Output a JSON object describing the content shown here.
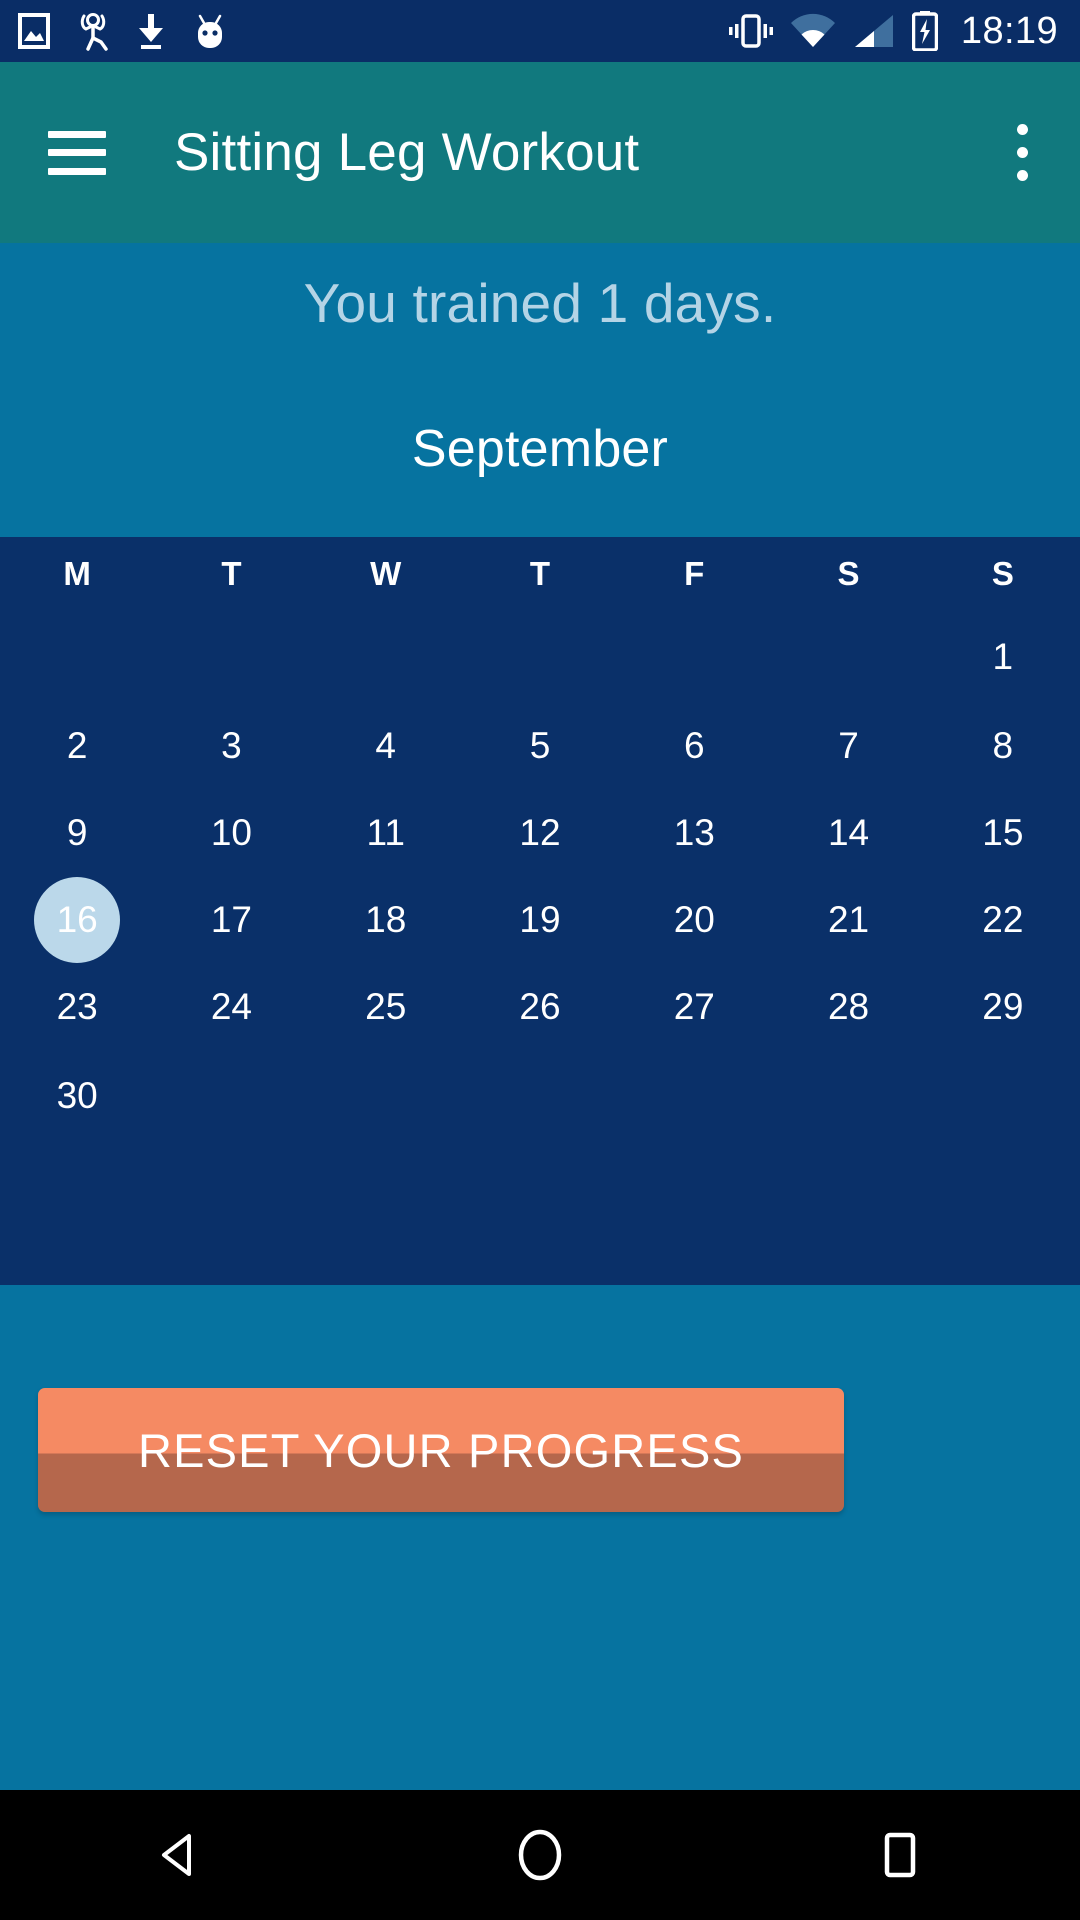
{
  "statusbar": {
    "time": "18:19",
    "left_icons": [
      {
        "name": "image-icon"
      },
      {
        "name": "exercise-person-icon"
      },
      {
        "name": "download-icon"
      },
      {
        "name": "android-mascot-icon"
      }
    ],
    "right_icons": [
      {
        "name": "vibrate-icon"
      },
      {
        "name": "wifi-icon"
      },
      {
        "name": "cellular-signal-icon"
      },
      {
        "name": "battery-charging-icon"
      }
    ]
  },
  "appbar": {
    "menu_icon": "hamburger-menu-icon",
    "title": "Sitting Leg Workout",
    "overflow_icon": "more-vert-icon"
  },
  "header": {
    "trained_text": "You trained 1 days.",
    "month": "September"
  },
  "calendar": {
    "weekday_headers": [
      "M",
      "T",
      "W",
      "T",
      "F",
      "S",
      "S"
    ],
    "weeks": [
      [
        null,
        null,
        null,
        null,
        null,
        null,
        "1"
      ],
      [
        "2",
        "3",
        "4",
        "5",
        "6",
        "7",
        "8"
      ],
      [
        "9",
        "10",
        "11",
        "12",
        "13",
        "14",
        "15"
      ],
      [
        "16",
        "17",
        "18",
        "19",
        "20",
        "21",
        "22"
      ],
      [
        "23",
        "24",
        "25",
        "26",
        "27",
        "28",
        "29"
      ],
      [
        "30",
        null,
        null,
        null,
        null,
        null,
        null
      ]
    ],
    "selected_day": "16"
  },
  "actions": {
    "reset_label": "RESET YOUR PROGRESS"
  },
  "navbar": {
    "back": "back-triangle-icon",
    "home": "home-circle-icon",
    "recents": "recents-square-icon"
  },
  "colors": {
    "statusbar_bg": "#0a2d66",
    "appbar_teal": "#11797e",
    "header_blue": "#0673a0",
    "calendar_navy": "#0a3069",
    "selected_day_bg": "#bbd8ea",
    "trained_text": "#b4d4e6",
    "button_top": "#f58a63",
    "button_bottom": "#b5674c",
    "navbar_bg": "#000000"
  }
}
